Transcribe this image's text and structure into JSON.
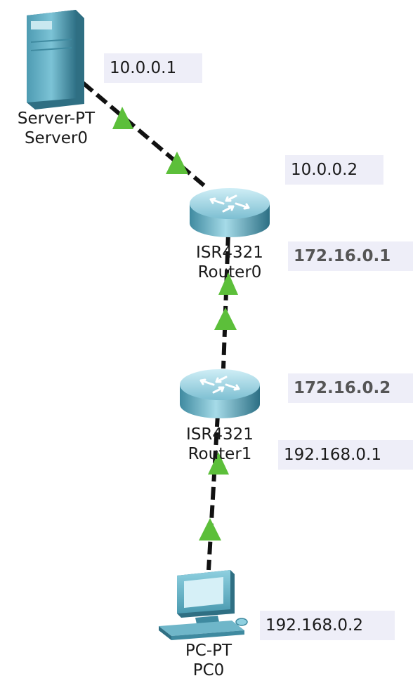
{
  "devices": {
    "server0": {
      "model": "Server-PT",
      "name": "Server0",
      "icon": "server-icon"
    },
    "router0": {
      "model": "ISR4321",
      "name": "Router0",
      "icon": "router-icon"
    },
    "router1": {
      "model": "ISR4321",
      "name": "Router1",
      "icon": "router-icon"
    },
    "pc0": {
      "model": "PC-PT",
      "name": "PC0",
      "icon": "pc-icon"
    }
  },
  "ips": {
    "server0": "10.0.0.1",
    "router0_a": "10.0.0.2",
    "router0_b": "172.16.0.1",
    "router1_a": "172.16.0.2",
    "router1_b": "192.168.0.1",
    "pc0": "192.168.0.2"
  },
  "colors": {
    "link": "#111111",
    "link_up": "#5cbf3a",
    "device_body": "#5aa8bd",
    "ip_box": "#eeeef8"
  }
}
